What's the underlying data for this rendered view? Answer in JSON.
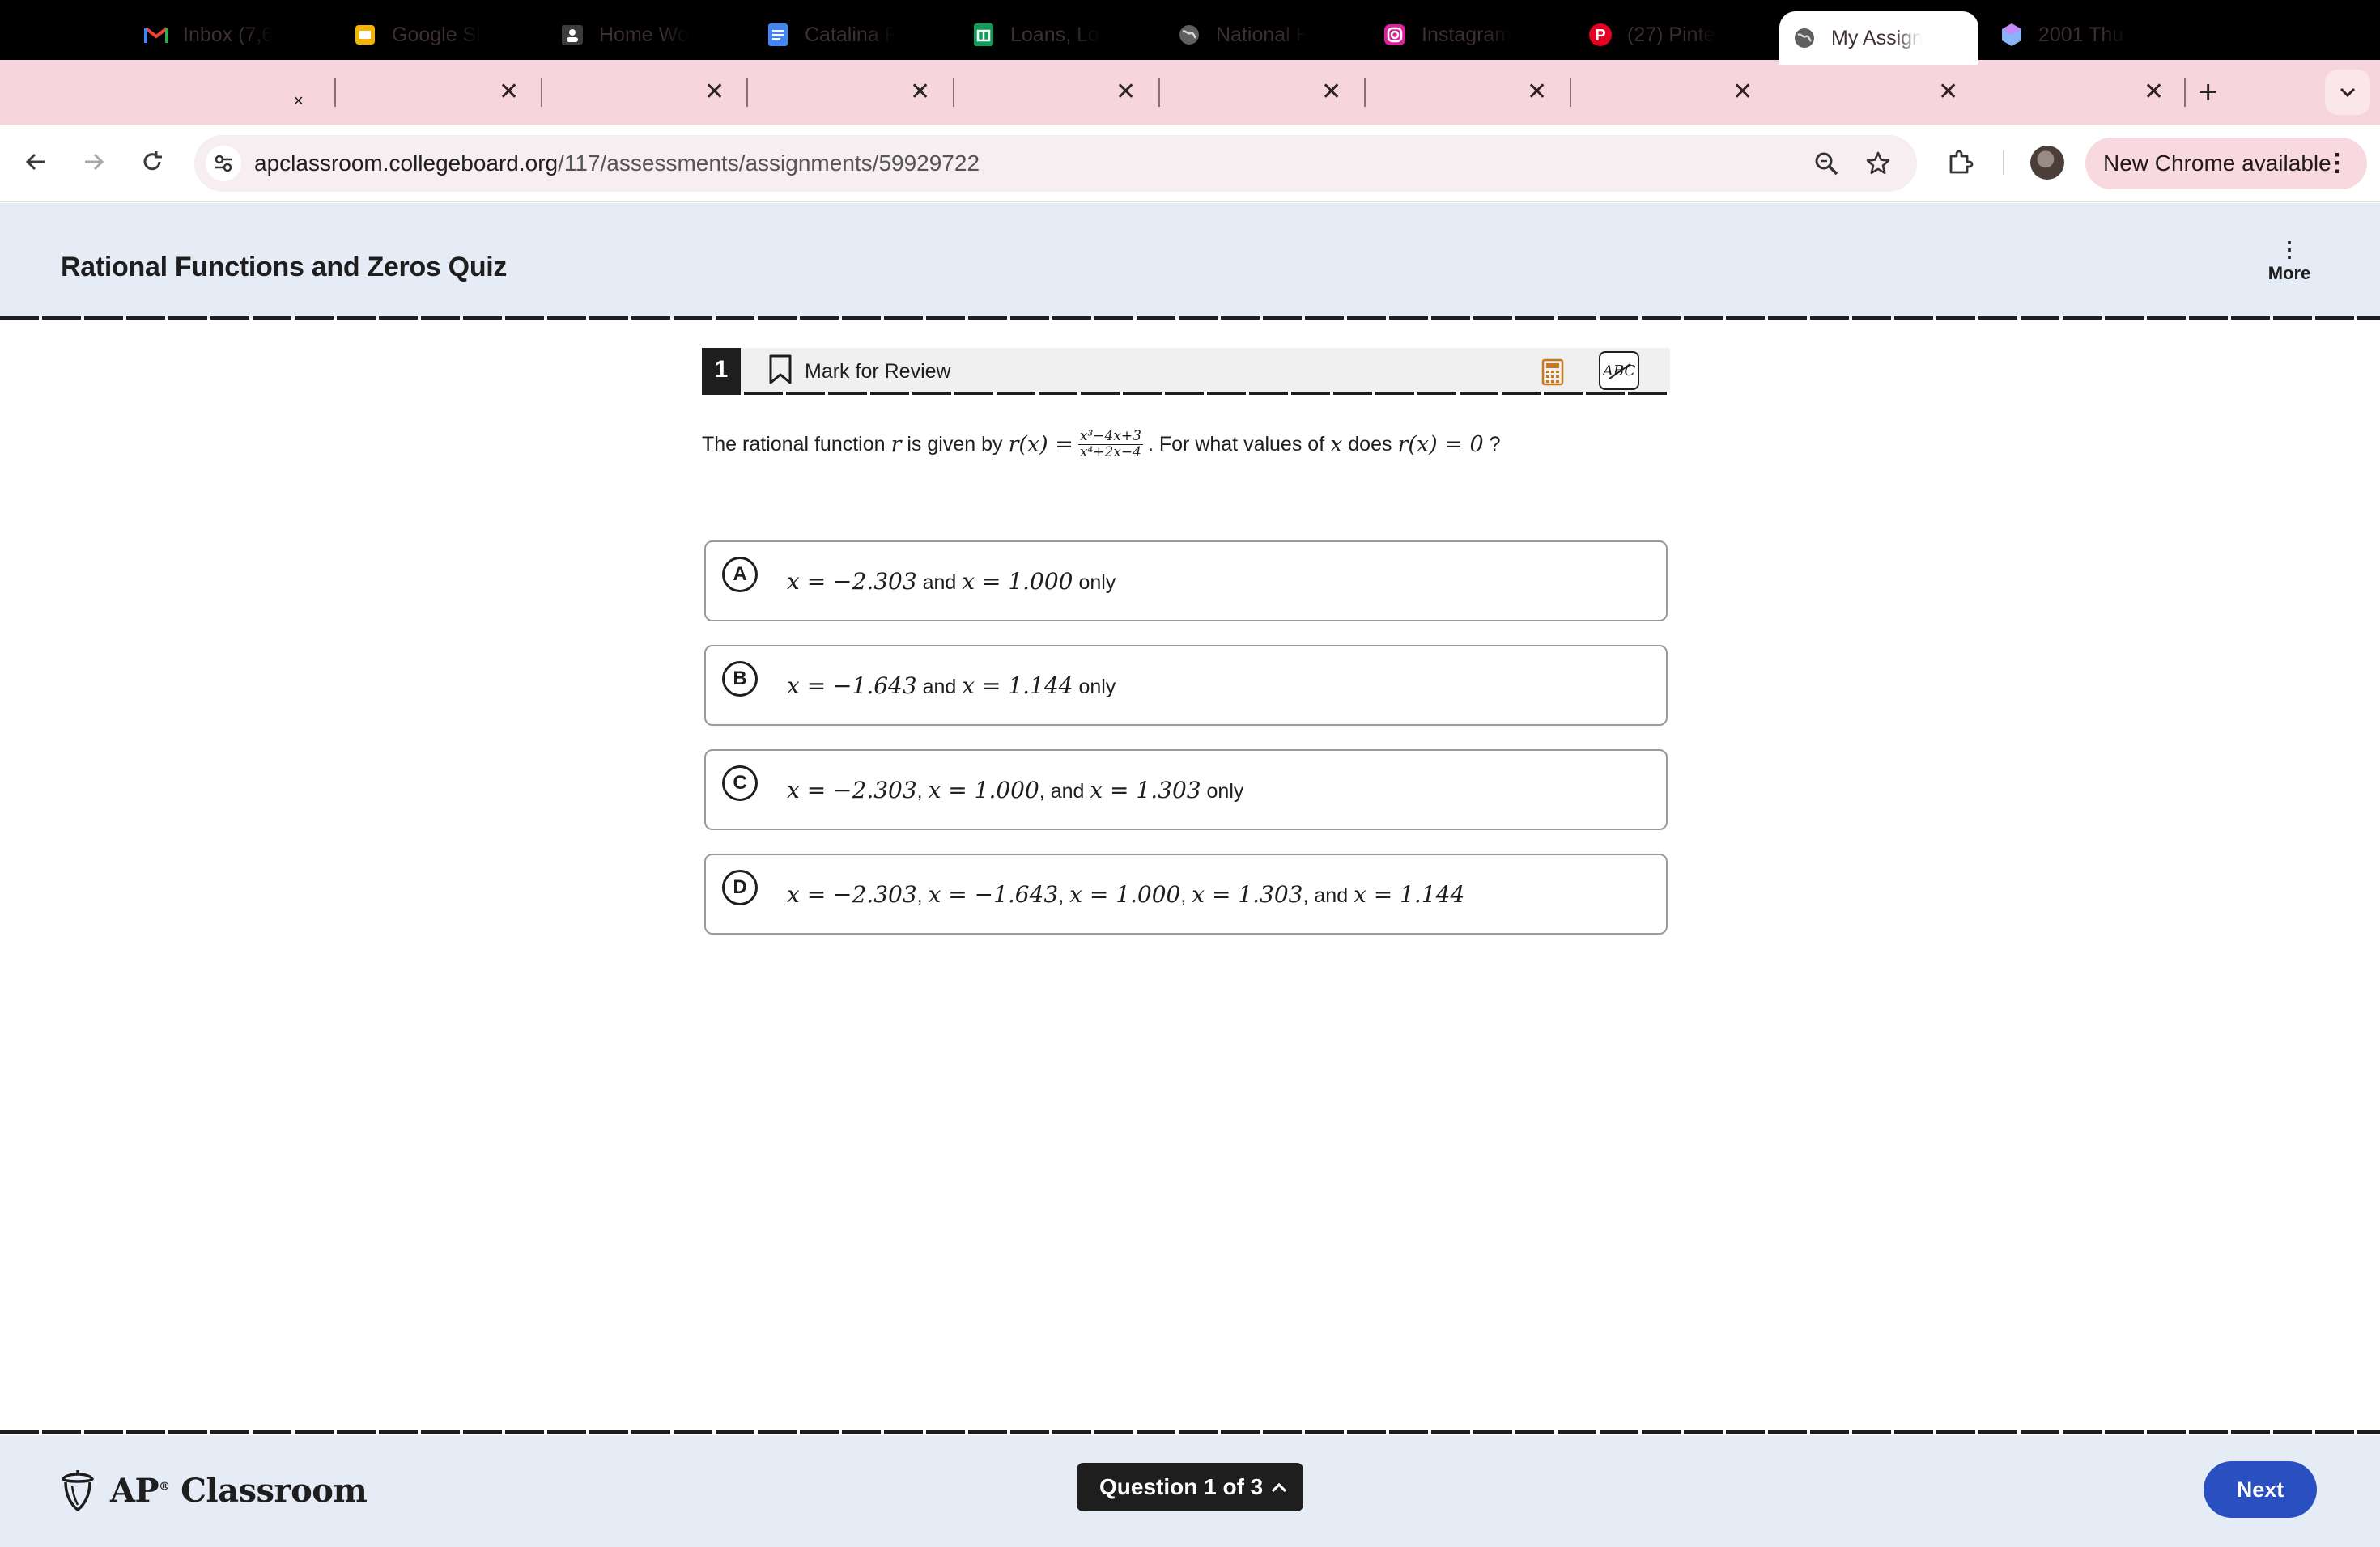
{
  "browser": {
    "tabs": [
      {
        "title": "Inbox (7,6",
        "icon": "gmail-icon",
        "active": false
      },
      {
        "title": "Google Sli",
        "icon": "google-slides-icon",
        "active": false
      },
      {
        "title": "Home Wo",
        "icon": "classroom-icon",
        "active": false
      },
      {
        "title": "Catalina R",
        "icon": "google-docs-icon",
        "active": false
      },
      {
        "title": "Loans, Lo",
        "icon": "google-sheets-icon",
        "active": false
      },
      {
        "title": "National H",
        "icon": "globe-icon",
        "active": false
      },
      {
        "title": "Instagram",
        "icon": "instagram-icon",
        "active": false
      },
      {
        "title": "(27) Pinte",
        "icon": "pinterest-icon",
        "active": false
      },
      {
        "title": "My Assign",
        "icon": "globe-icon",
        "active": true
      },
      {
        "title": "2001 Thu",
        "icon": "gem-icon",
        "active": false
      }
    ],
    "url": {
      "host": "apclassroom.collegeboard.org",
      "path": "/117/assessments/assignments/59929722"
    },
    "update_label": "New Chrome available"
  },
  "quiz": {
    "title": "Rational Functions and Zeros Quiz",
    "more_label": "More"
  },
  "question": {
    "number": "1",
    "mark_label": "Mark for Review",
    "abc_label": "ABC",
    "stem": {
      "t1": "The rational function",
      "t2": "is given by",
      "t3": ". For what values of",
      "t4": "does",
      "t5": "?",
      "var_r": "r",
      "var_x": "x",
      "func": "r(x) =",
      "numerator": "x³−4x+3",
      "denominator": "x⁴+2x−4",
      "func2": "r(x) = 0"
    },
    "choices": [
      {
        "letter": "A",
        "parts": [
          "x = −2.303",
          " and ",
          "x = 1.000",
          " only"
        ]
      },
      {
        "letter": "B",
        "parts": [
          "x = −1.643",
          " and ",
          "x = 1.144",
          " only"
        ]
      },
      {
        "letter": "C",
        "parts": [
          "x = −2.303",
          ", ",
          "x = 1.000",
          ", and ",
          "x = 1.303",
          " only"
        ]
      },
      {
        "letter": "D",
        "parts": [
          "x = −2.303",
          ", ",
          "x = −1.643",
          ", ",
          "x = 1.000",
          ", ",
          "x = 1.303",
          ", and ",
          "x = 1.144"
        ]
      }
    ]
  },
  "footer": {
    "logo_text": "AP Classroom",
    "logo_ap": "AP",
    "logo_classroom": "Classroom",
    "question_nav": "Question 1 of 3",
    "next_label": "Next"
  },
  "colors": {
    "tabstrip": "#f7d5dc",
    "header_bg": "#e6ecf6",
    "next_button": "#2a4fc1",
    "question_badge": "#1e1e1e"
  }
}
